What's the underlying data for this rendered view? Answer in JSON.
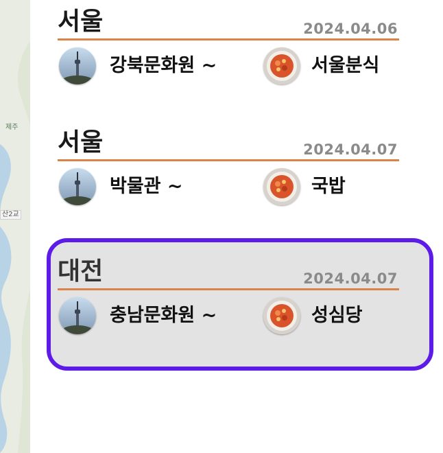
{
  "map": {
    "labels": [
      "제주",
      "산2교"
    ]
  },
  "trips": [
    {
      "city": "서울",
      "date": "2024.04.06",
      "place": "강북문화원 ~",
      "food": "서울분식",
      "selected": false
    },
    {
      "city": "서울",
      "date": "2024.04.07",
      "place": "박물관 ~",
      "food": "국밥",
      "selected": false
    },
    {
      "city": "대전",
      "date": "2024.04.07",
      "place": "충남문화원 ~",
      "food": "성심당",
      "selected": true
    }
  ],
  "colors": {
    "divider": "#d9824a",
    "selected_border": "#5c1be8",
    "selected_bg": "#e3e3e3",
    "date_text": "#8a8a8a"
  },
  "icons": {
    "place": "tower-photo-icon",
    "food": "food-photo-icon"
  }
}
